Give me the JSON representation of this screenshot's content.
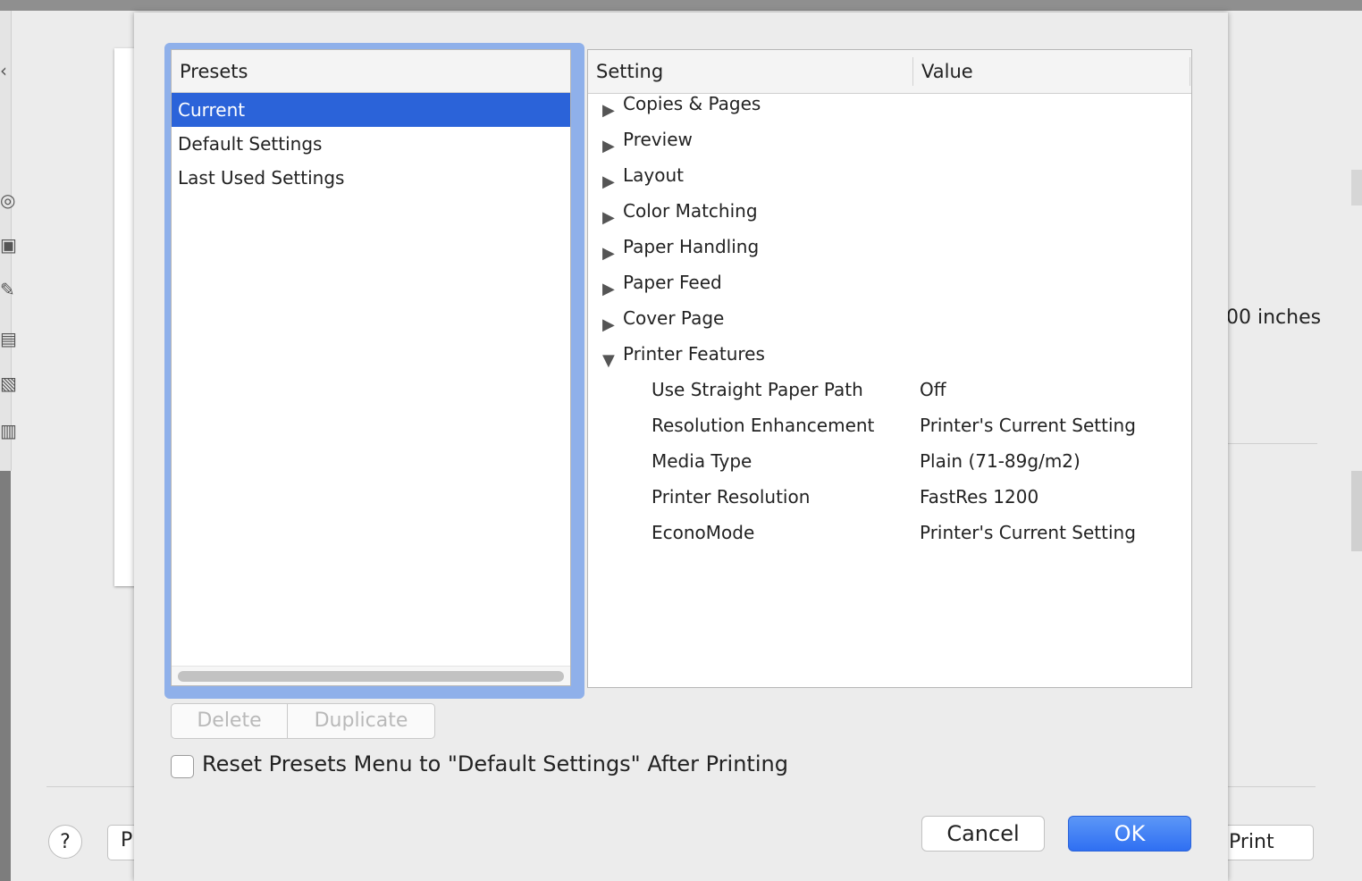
{
  "background": {
    "inches_text": "00 inches",
    "help_label": "?",
    "pdf_label": "P",
    "print_label": "Print"
  },
  "presets": {
    "header": "Presets",
    "items": [
      {
        "label": "Current",
        "selected": true
      },
      {
        "label": "Default Settings",
        "selected": false
      },
      {
        "label": "Last Used Settings",
        "selected": false
      }
    ],
    "delete_label": "Delete",
    "duplicate_label": "Duplicate"
  },
  "settings": {
    "col_setting": "Setting",
    "col_value": "Value",
    "sections": [
      {
        "label": "Copies & Pages",
        "expanded": false
      },
      {
        "label": "Preview",
        "expanded": false
      },
      {
        "label": "Layout",
        "expanded": false
      },
      {
        "label": "Color Matching",
        "expanded": false
      },
      {
        "label": "Paper Handling",
        "expanded": false
      },
      {
        "label": "Paper Feed",
        "expanded": false
      },
      {
        "label": "Cover Page",
        "expanded": false
      },
      {
        "label": "Printer Features",
        "expanded": true
      }
    ],
    "features": [
      {
        "setting": "Use Straight Paper Path",
        "value": "Off"
      },
      {
        "setting": "Resolution Enhancement",
        "value": "Printer's Current Setting"
      },
      {
        "setting": "Media Type",
        "value": "Plain (71-89g/m2)"
      },
      {
        "setting": "Printer Resolution",
        "value": "FastRes 1200"
      },
      {
        "setting": "EconoMode",
        "value": "Printer's Current Setting"
      }
    ]
  },
  "reset_checkbox": {
    "label": "Reset Presets Menu to \"Default Settings\" After Printing",
    "checked": false
  },
  "buttons": {
    "cancel": "Cancel",
    "ok": "OK"
  },
  "colors": {
    "selection": "#2b63d9",
    "focus_ring": "#8fb0ea",
    "ok_button": "#3a7af3"
  }
}
